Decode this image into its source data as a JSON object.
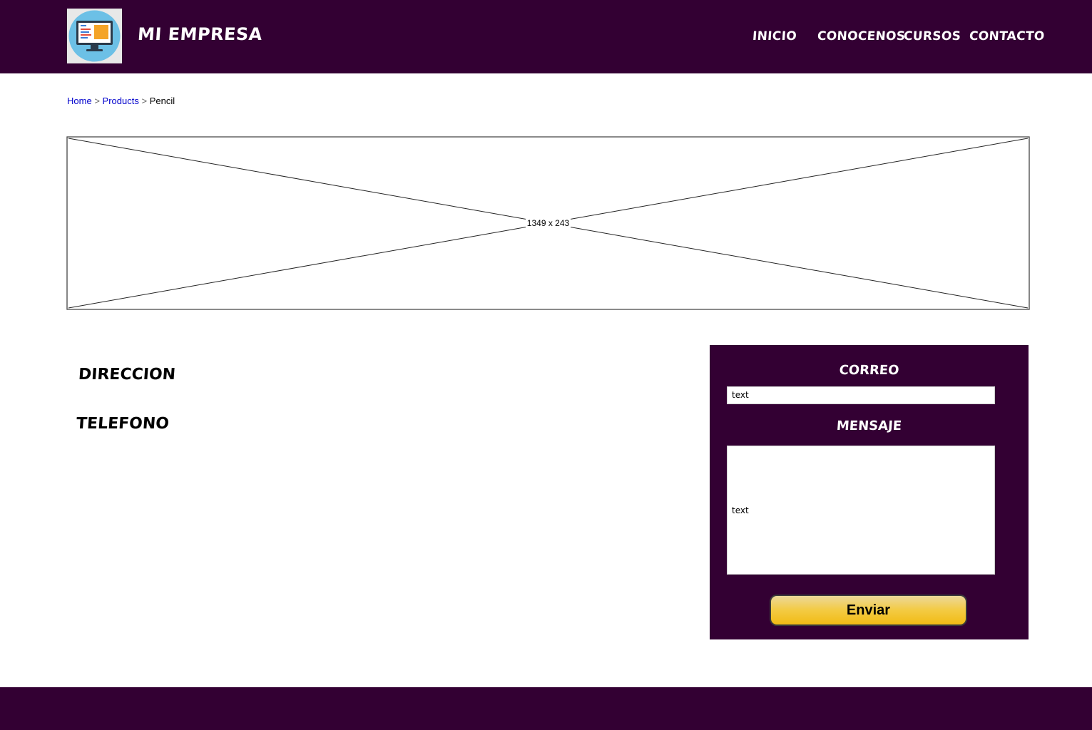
{
  "header": {
    "brand": "MI EMPRESA",
    "nav": [
      "INICIO",
      "CONOCENOS",
      "CURSOS",
      "CONTACTO"
    ]
  },
  "breadcrumb": {
    "home": "Home",
    "products": "Products",
    "current": "Pencil",
    "separator": ">"
  },
  "banner": {
    "placeholder_label": "1349 x 243"
  },
  "info": {
    "address_label": "DIRECCION",
    "phone_label": "TELEFONO"
  },
  "contact_form": {
    "email_heading": "CORREO",
    "email_value": "text",
    "message_heading": "MENSAJE",
    "message_value": "text",
    "submit_label": "Enviar"
  },
  "colors": {
    "brand_purple": "#330033",
    "link_blue": "#0000cc",
    "button_gold": "#f3cb45"
  },
  "icons": {
    "logo": "computer-monitor-icon"
  }
}
